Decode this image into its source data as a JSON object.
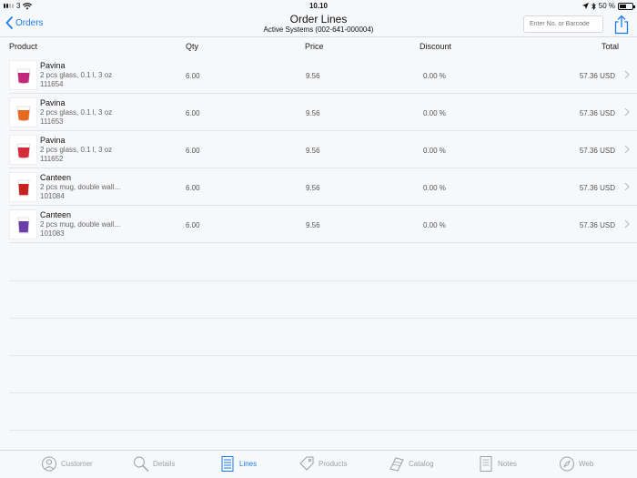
{
  "status": {
    "carrier": "3",
    "time": "10.10",
    "battery": "50 %",
    "battery_level": 0.5
  },
  "nav": {
    "back_label": "Orders",
    "title": "Order Lines",
    "subtitle": "Active Systems (002-641-000004)",
    "search_placeholder": "Enter No. or Barcode"
  },
  "table": {
    "headers": {
      "product": "Product",
      "qty": "Qty",
      "price": "Price",
      "discount": "Discount",
      "total": "Total"
    },
    "rows": [
      {
        "name": "Pavina",
        "desc": "2 pcs glass, 0.1 l, 3 oz",
        "no": "111654",
        "qty": "6.00",
        "price": "9.56",
        "discount": "0.00 %",
        "total": "57.36 USD",
        "color": "#c22a7a"
      },
      {
        "name": "Pavina",
        "desc": "2 pcs glass, 0.1 l, 3 oz",
        "no": "111653",
        "qty": "6.00",
        "price": "9.56",
        "discount": "0.00 %",
        "total": "57.36 USD",
        "color": "#e86a1e"
      },
      {
        "name": "Pavina",
        "desc": "2 pcs glass, 0.1 l, 3 oz",
        "no": "111652",
        "qty": "6.00",
        "price": "9.56",
        "discount": "0.00 %",
        "total": "57.36 USD",
        "color": "#d22b3a"
      },
      {
        "name": "Canteen",
        "desc": "2 pcs mug, double wall...",
        "no": "101084",
        "qty": "6.00",
        "price": "9.56",
        "discount": "0.00 %",
        "total": "57.36 USD",
        "color": "#c8221f"
      },
      {
        "name": "Canteen",
        "desc": "2 pcs mug, double wall...",
        "no": "101083",
        "qty": "6.00",
        "price": "9.56",
        "discount": "0.00 %",
        "total": "57.36 USD",
        "color": "#6a3fa8"
      }
    ]
  },
  "tabs": [
    {
      "label": "Customer",
      "icon": "customer-icon",
      "active": false
    },
    {
      "label": "Details",
      "icon": "magnifier-icon",
      "active": false
    },
    {
      "label": "Lines",
      "icon": "lines-icon",
      "active": true
    },
    {
      "label": "Products",
      "icon": "tag-icon",
      "active": false
    },
    {
      "label": "Catalog",
      "icon": "catalog-icon",
      "active": false
    },
    {
      "label": "Notes",
      "icon": "notes-icon",
      "active": false
    },
    {
      "label": "Web",
      "icon": "compass-icon",
      "active": false
    }
  ],
  "colors": {
    "accent": "#1a7cf0",
    "inactive": "#9aa0a6"
  }
}
